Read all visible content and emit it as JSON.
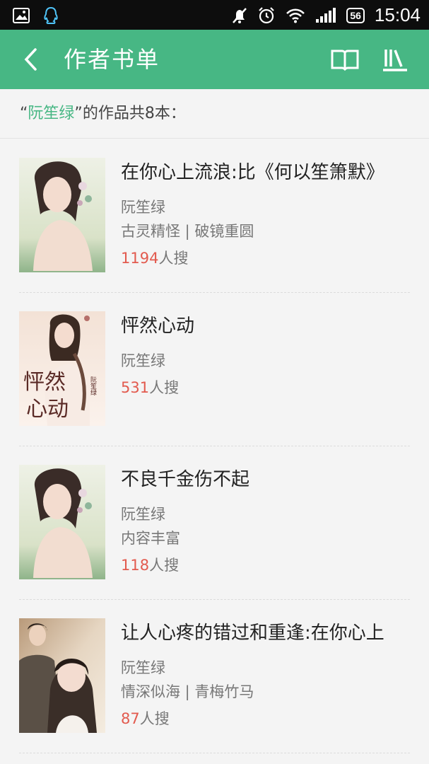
{
  "status_bar": {
    "time": "15:04",
    "battery": "56",
    "icons": [
      "image-icon",
      "qq-icon",
      "mute-icon",
      "alarm-icon",
      "wifi-icon",
      "signal-icon",
      "battery-icon"
    ]
  },
  "header": {
    "title": "作者书单",
    "bg_color": "#47b784",
    "icons": [
      "back-icon",
      "book-icon",
      "bookshelf-icon"
    ]
  },
  "summary": {
    "open_quote": "“",
    "author": "阮笙绿",
    "close_quote": "”",
    "suffix": "的作品共8本："
  },
  "books": [
    {
      "title": "在你心上流浪:比《何以笙箫默》",
      "author": "阮笙绿",
      "tags": "古灵精怪 | 破镜重圆",
      "hits": "1194",
      "hits_suffix": "人搜"
    },
    {
      "title": "怦然心动",
      "author": "阮笙绿",
      "tags": "",
      "hits": "531",
      "hits_suffix": "人搜"
    },
    {
      "title": "不良千金伤不起",
      "author": "阮笙绿",
      "tags": "内容丰富",
      "hits": "118",
      "hits_suffix": "人搜"
    },
    {
      "title": "让人心疼的错过和重逢:在你心上",
      "author": "阮笙绿",
      "tags": "情深似海 | 青梅竹马",
      "hits": "87",
      "hits_suffix": "人搜"
    }
  ],
  "cover_art": {
    "book2_title_chars": "怦然心动",
    "book2_author_text": "阮笙绿"
  }
}
